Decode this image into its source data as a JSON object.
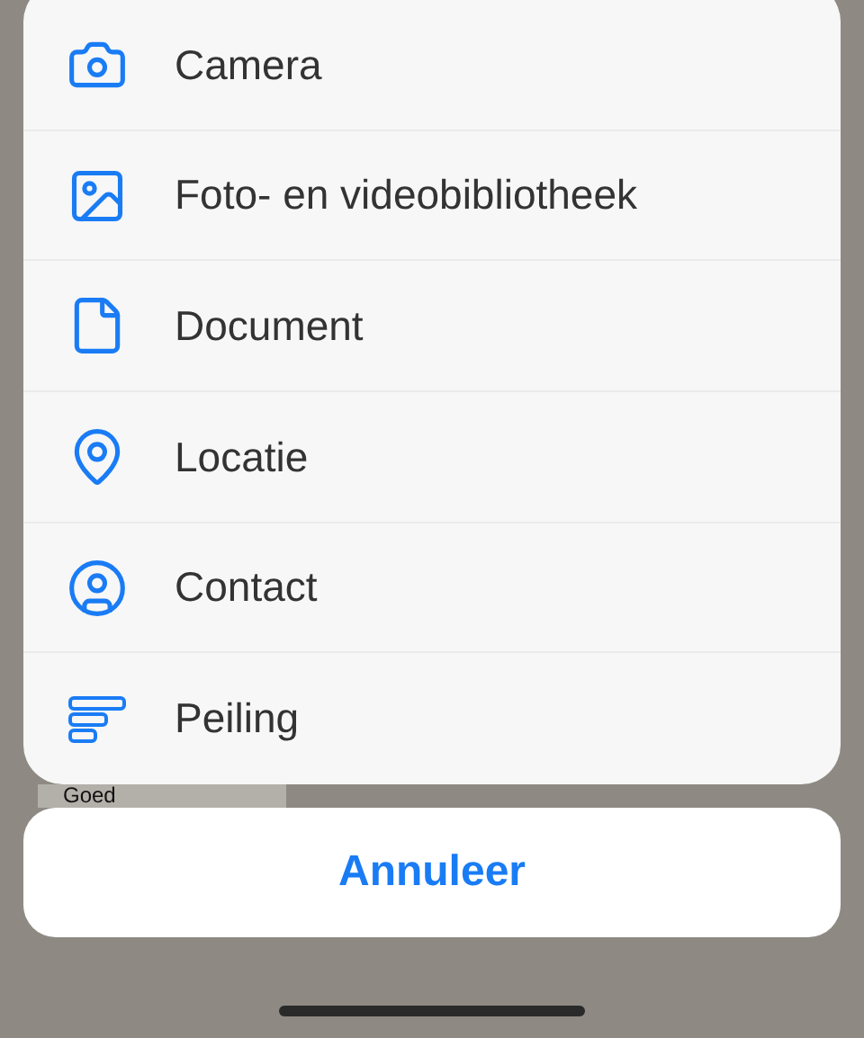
{
  "menu": [
    {
      "kind": "camera",
      "label": "Camera"
    },
    {
      "kind": "photo",
      "label": "Foto- en videobibliotheek"
    },
    {
      "kind": "document",
      "label": "Document"
    },
    {
      "kind": "location",
      "label": "Locatie"
    },
    {
      "kind": "contact",
      "label": "Contact"
    },
    {
      "kind": "poll",
      "label": "Peiling"
    }
  ],
  "background_message": {
    "text": "Goed"
  },
  "cancel_button": "Annuleer"
}
